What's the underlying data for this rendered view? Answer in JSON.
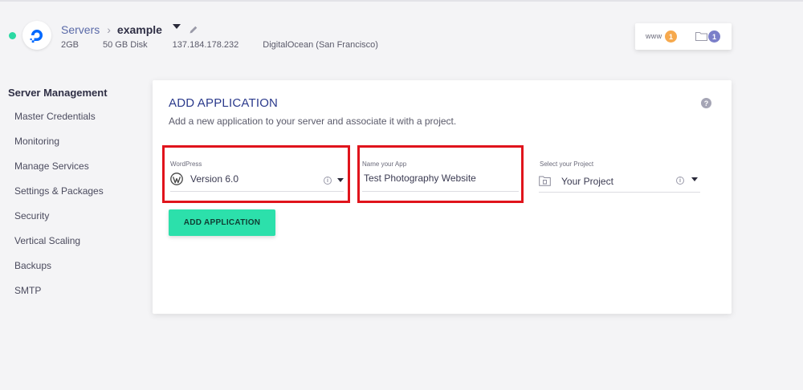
{
  "header": {
    "breadcrumb": {
      "root": "Servers",
      "current": "example"
    },
    "meta": {
      "ram": "2GB",
      "disk": "50 GB Disk",
      "ip": "137.184.178.232",
      "provider": "DigitalOcean (San Francisco)"
    },
    "counters": {
      "www_label": "www",
      "apps_count": "1",
      "projects_count": "1"
    }
  },
  "sidebar": {
    "title": "Server Management",
    "items": [
      {
        "label": "Master Credentials"
      },
      {
        "label": "Monitoring"
      },
      {
        "label": "Manage Services"
      },
      {
        "label": "Settings & Packages"
      },
      {
        "label": "Security"
      },
      {
        "label": "Vertical Scaling"
      },
      {
        "label": "Backups"
      },
      {
        "label": "SMTP"
      }
    ]
  },
  "card": {
    "title": "ADD APPLICATION",
    "subtitle": "Add a new application to your server and associate it with a project.",
    "help_icon": "?",
    "app_select": {
      "label": "WordPress",
      "value": "Version 6.0"
    },
    "name_input": {
      "label": "Name your App",
      "value": "Test Photography Website"
    },
    "project_select": {
      "label": "Select your Project",
      "value": "Your Project"
    },
    "submit_label": "ADD APPLICATION"
  },
  "colors": {
    "accent": "#2ce0ab",
    "title_blue": "#2b3a8c",
    "highlight_red": "#e0141c",
    "status_green": "#2bd9a3"
  }
}
